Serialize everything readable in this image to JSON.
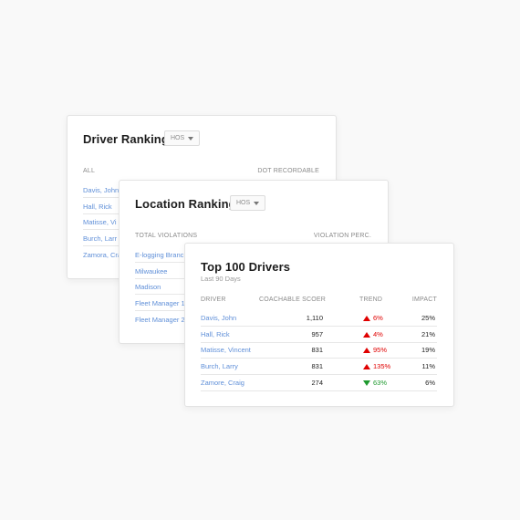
{
  "colors": {
    "link": "#5f8fd8",
    "up": "#e00000",
    "down": "#1f9a2f"
  },
  "driver_ranking": {
    "title": "Driver Ranking",
    "filter": "HOS",
    "col_all": "ALL",
    "col_dot": "DOT RECORDABLE",
    "rows": [
      "Davis, John",
      "Hall, Rick",
      "Matisse, Vi",
      "Burch, Larr",
      "Zamora, Cra"
    ]
  },
  "location_ranking": {
    "title": "Location Ranking",
    "filter": "HOS",
    "col_total": "TOTAL VIOLATIONS",
    "col_perc": "VIOLATION PERC.",
    "rows": [
      "E-logging Branc",
      "Milwaukee",
      "Madison",
      "Fleet Manager 1",
      "Fleet Manager 2"
    ]
  },
  "top_drivers": {
    "title": "Top 100 Drivers",
    "subtitle": "Last 90 Days",
    "headers": {
      "driver": "DRIVER",
      "score": "COACHABLE SCOER",
      "trend": "TREND",
      "impact": "IMPACT"
    },
    "rows": [
      {
        "driver": "Davis, John",
        "score": "1,110",
        "trend": "6%",
        "direction": "up",
        "impact": "25%"
      },
      {
        "driver": "Hall, Rick",
        "score": "957",
        "trend": "4%",
        "direction": "up",
        "impact": "21%"
      },
      {
        "driver": "Matisse, Vincent",
        "score": "831",
        "trend": "95%",
        "direction": "up",
        "impact": "19%"
      },
      {
        "driver": "Burch, Larry",
        "score": "831",
        "trend": "135%",
        "direction": "up",
        "impact": "11%"
      },
      {
        "driver": "Zamore, Craig",
        "score": "274",
        "trend": "63%",
        "direction": "down",
        "impact": "6%"
      }
    ]
  }
}
